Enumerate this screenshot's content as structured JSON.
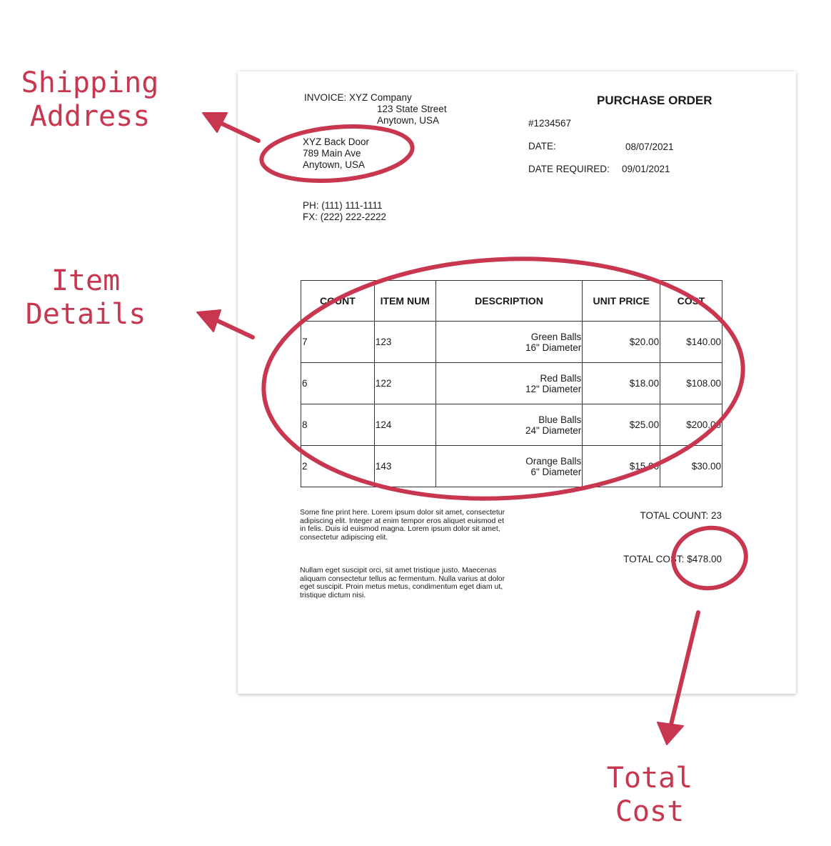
{
  "annotations": {
    "shipping": "Shipping\nAddress",
    "items": "Item\nDetails",
    "total": "Total\nCost"
  },
  "colors": {
    "annotation": "#c8374f"
  },
  "invoice": {
    "invoice_label": "INVOICE:",
    "company": "XYZ Company",
    "company_street": "123 State Street",
    "company_city": "Anytown, USA",
    "ship_to": [
      "XYZ Back Door",
      "789 Main Ave",
      "Anytown, USA"
    ],
    "phone": "PH: (111) 111-1111",
    "fax": "FX: (222) 222-2222",
    "title": "PURCHASE ORDER",
    "number": "#1234567",
    "date_label": "DATE:",
    "date": "08/07/2021",
    "date_required_label": "DATE REQUIRED:",
    "date_required": "09/01/2021"
  },
  "table": {
    "headers": [
      "COUNT",
      "ITEM NUM",
      "DESCRIPTION",
      "UNIT PRICE",
      "COST"
    ],
    "rows": [
      {
        "count": "7",
        "item": "123",
        "desc1": "Green Balls",
        "desc2": "16\" Diameter",
        "price": "$20.00",
        "cost": "$140.00"
      },
      {
        "count": "6",
        "item": "122",
        "desc1": "Red Balls",
        "desc2": "12\" Diameter",
        "price": "$18.00",
        "cost": "$108.00"
      },
      {
        "count": "8",
        "item": "124",
        "desc1": "Blue Balls",
        "desc2": "24\" Diameter",
        "price": "$25.00",
        "cost": "$200.00"
      },
      {
        "count": "2",
        "item": "143",
        "desc1": "Orange Balls",
        "desc2": "6\" Diameter",
        "price": "$15.00",
        "cost": "$30.00"
      }
    ]
  },
  "fine_print": [
    "Some fine print here. Lorem ipsum dolor sit amet, consectetur adipiscing elit. Integer at enim tempor eros aliquet euismod et in felis. Duis id euismod magna. Lorem ipsum dolor sit amet, consectetur adipiscing elit.",
    "Nullam eget suscipit orci, sit amet tristique justo. Maecenas aliquam consectetur tellus ac fermentum. Nulla varius at dolor eget suscipit. Proin metus metus, condimentum eget diam ut, tristique dictum nisi."
  ],
  "totals": {
    "count_label": "TOTAL COUNT:",
    "count": "23",
    "cost_label": "TOTAL COST:",
    "cost": "$478.00"
  }
}
